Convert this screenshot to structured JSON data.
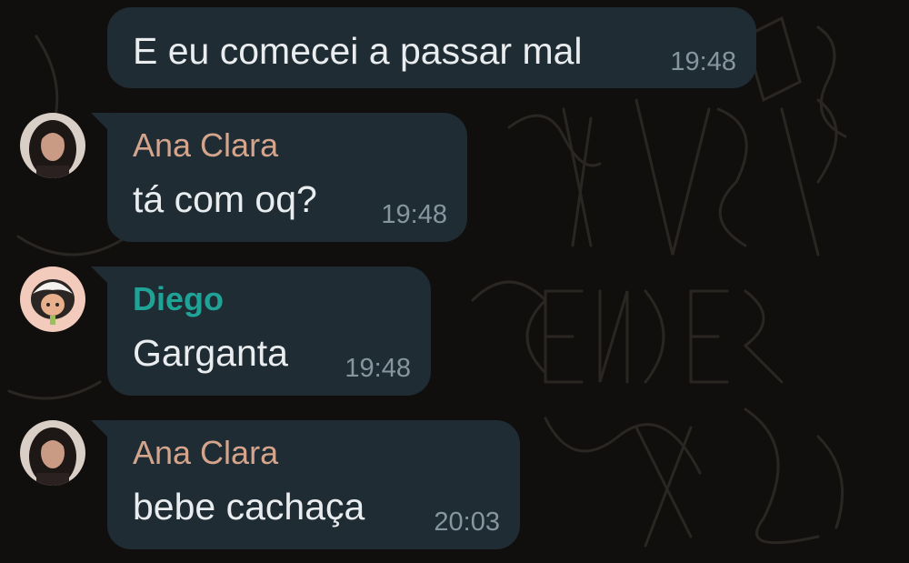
{
  "colors": {
    "bubble": "#1f2c33",
    "message_text": "#e9edef",
    "timestamp": "#8696a0",
    "sender_ana_clara": "#d4a58c",
    "sender_diego": "#1fa397"
  },
  "messages": [
    {
      "sender": "",
      "text": "E eu comecei a passar mal",
      "time": "19:48"
    },
    {
      "sender": "Ana Clara",
      "text": "tá com oq?",
      "time": "19:48",
      "avatar_icon": "user-photo-icon"
    },
    {
      "sender": "Diego",
      "text": "Garganta",
      "time": "19:48",
      "avatar_icon": "cartoon-avatar-icon"
    },
    {
      "sender": "Ana Clara",
      "text": "bebe cachaça",
      "time": "20:03",
      "avatar_icon": "user-photo-icon"
    }
  ]
}
